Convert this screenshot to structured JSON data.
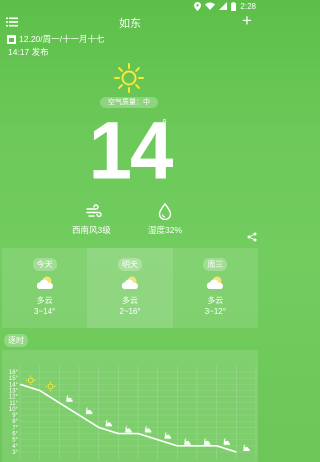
{
  "status_bar": {
    "time": "2:28"
  },
  "header": {
    "city": "如东",
    "add_label": "+"
  },
  "publish": {
    "date_line": "12.20/周一/十一月十七",
    "time_line": "14:17 发布"
  },
  "current": {
    "weather_icon": "sun-icon",
    "aqi": "空气质量：中",
    "temperature": "14",
    "degree": "°",
    "wind": "西南风3级",
    "humidity": "湿度32%"
  },
  "forecast": [
    {
      "day": "今天",
      "icon": "cloud-icon",
      "condition": "多云",
      "range": "3~14°"
    },
    {
      "day": "明天",
      "icon": "cloud-icon",
      "condition": "多云",
      "range": "2~16°"
    },
    {
      "day": "周三",
      "icon": "cloud-icon",
      "condition": "多云",
      "range": "3~12°"
    }
  ],
  "hourly": {
    "label": "逐时",
    "y_ticks": [
      "16°",
      "15°",
      "14°",
      "13°",
      "12°",
      "11°",
      "10°",
      "9°",
      "8°",
      "7°",
      "6°",
      "5°",
      "4°",
      "3°"
    ]
  },
  "chart_data": {
    "type": "line",
    "title": "",
    "xlabel": "",
    "ylabel": "",
    "ylim": [
      3,
      16
    ],
    "y_ticks": [
      16,
      15,
      14,
      13,
      12,
      11,
      10,
      9,
      8,
      7,
      6,
      5,
      4,
      3
    ],
    "x": [
      1,
      2,
      3,
      4,
      5,
      6,
      7,
      8,
      9,
      10,
      11,
      12
    ],
    "series": [
      {
        "values": [
          14,
          13,
          11,
          9,
          7,
          6,
          6,
          5,
          4,
          4,
          4,
          3
        ]
      }
    ],
    "icons": [
      "sun",
      "sun",
      "moon-cloud",
      "moon-cloud",
      "moon-cloud",
      "moon-cloud",
      "moon-cloud",
      "moon-cloud",
      "moon-cloud",
      "moon-cloud",
      "moon-cloud",
      "moon-cloud"
    ],
    "grid": true
  }
}
